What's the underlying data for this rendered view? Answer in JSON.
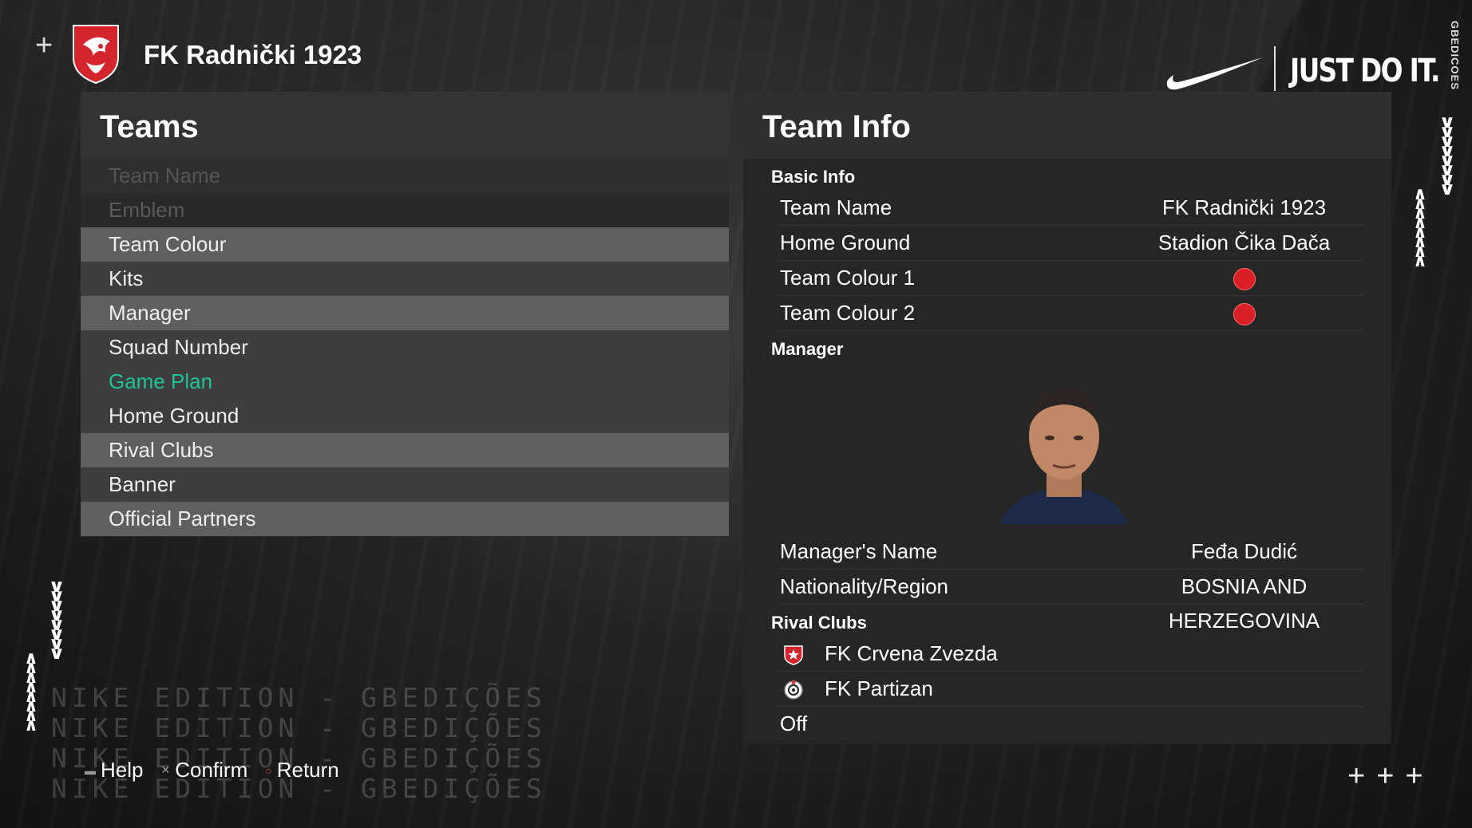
{
  "header": {
    "team_title": "FK Radnički 1923",
    "plus_symbol": "+",
    "brand_slogan": "JUST DO IT.",
    "brand_vertical": "GBEDICOES",
    "crest_icon": "club-crest-icon"
  },
  "teams_panel": {
    "title": "Teams",
    "items": [
      {
        "label": "Team Name"
      },
      {
        "label": "Emblem"
      },
      {
        "label": "Team Colour"
      },
      {
        "label": "Kits"
      },
      {
        "label": "Manager"
      },
      {
        "label": "Squad Number"
      },
      {
        "label": "Game Plan"
      },
      {
        "label": "Home Ground"
      },
      {
        "label": "Rival Clubs"
      },
      {
        "label": "Banner"
      },
      {
        "label": "Official Partners"
      }
    ],
    "selected": "Game Plan"
  },
  "info_panel": {
    "title": "Team Info",
    "basic_info": {
      "heading": "Basic Info",
      "rows": [
        {
          "label": "Team Name",
          "value": "FK Radnički 1923"
        },
        {
          "label": "Home Ground",
          "value": "Stadion Čika Dača"
        },
        {
          "label": "Team Colour 1",
          "color": "#d92027"
        },
        {
          "label": "Team Colour 2",
          "color": "#d92027"
        }
      ]
    },
    "manager": {
      "heading": "Manager",
      "rows": [
        {
          "label": "Manager's Name",
          "value": "Feđa Dudić"
        },
        {
          "label": "Nationality/Region",
          "value": "BOSNIA AND HERZEGOVINA"
        }
      ]
    },
    "rival_clubs": {
      "heading": "Rival Clubs",
      "clubs": [
        {
          "name": "FK Crvena Zvezda",
          "icon": "crvena-zvezda-crest-icon"
        },
        {
          "name": "FK Partizan",
          "icon": "partizan-crest-icon"
        }
      ],
      "status": "Off"
    }
  },
  "footer": {
    "edition_line": "NIKE EDITION - GBEDIÇÕES",
    "help": "Help",
    "confirm": "Confirm",
    "return": "Return",
    "plus_row": "+++"
  },
  "colors": {
    "accent": "#1fc396",
    "team_colour": "#d92027"
  }
}
